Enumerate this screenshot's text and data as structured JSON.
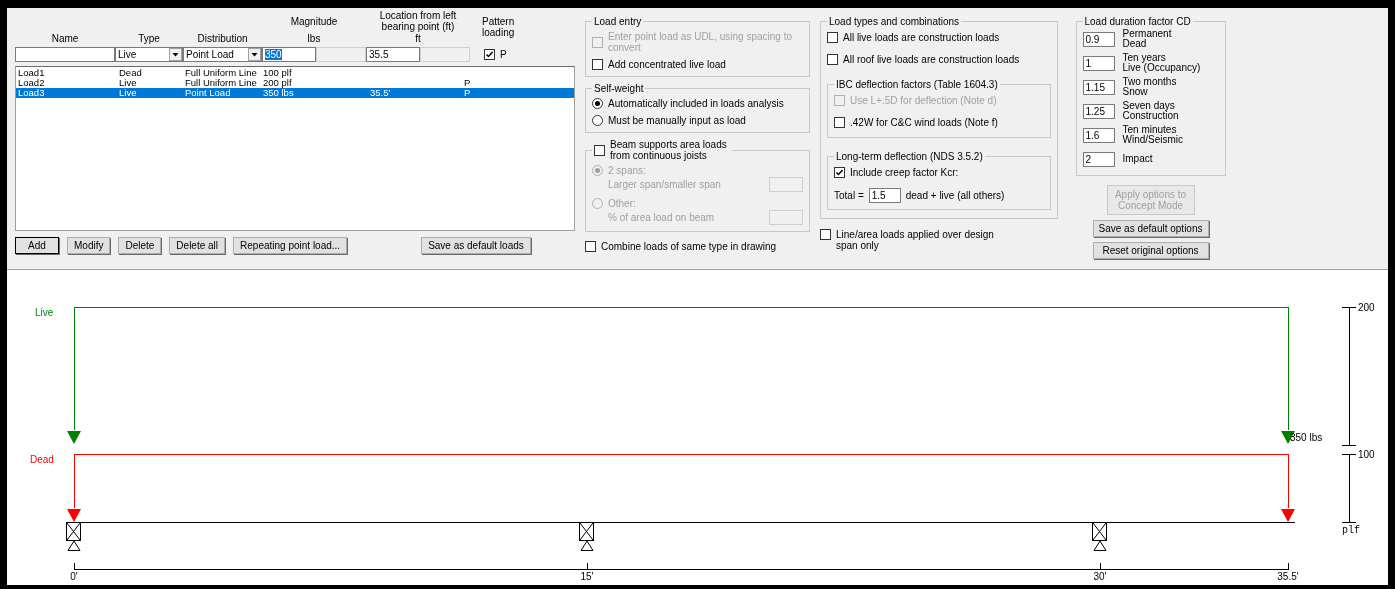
{
  "entry_form": {
    "headers": {
      "name": "Name",
      "type": "Type",
      "distribution": "Distribution",
      "magnitude": "Magnitude",
      "magnitude_unit": "lbs",
      "location": "Location from left bearing point (ft)",
      "location_unit": "ft",
      "pattern": "Pattern loading"
    },
    "type": "Live",
    "distribution": "Point Load",
    "magnitude": "350",
    "location": "35.5",
    "pattern": {
      "label": "P",
      "checked": true
    }
  },
  "loads": [
    {
      "name": "Load1",
      "type": "Dead",
      "distribution": "Full Uniform Line",
      "magnitude": "100 plf",
      "selected": false
    },
    {
      "name": "Load2",
      "type": "Live",
      "distribution": "Full Uniform Line",
      "magnitude": "200 plf",
      "pattern": "P",
      "selected": false
    },
    {
      "name": "Load3",
      "type": "Live",
      "distribution": "Point Load",
      "magnitude": "350 lbs",
      "location": "35.5'",
      "pattern": "P",
      "selected": true
    }
  ],
  "load_buttons": [
    "Add",
    "Modify",
    "Delete",
    "Delete all",
    "Repeating point load..."
  ],
  "save_loads_button": "Save as default loads",
  "load_entry": {
    "title": "Load entry",
    "options": [
      {
        "label": "Enter point load as UDL, using spacing to convert",
        "checked": false,
        "disabled": true
      },
      {
        "label": "Add concentrated live load",
        "checked": false,
        "disabled": false
      }
    ]
  },
  "self_weight": {
    "title": "Self-weight",
    "options": [
      {
        "label": "Automatically included in loads analysis",
        "selected": true
      },
      {
        "label": "Must be manually input as load",
        "selected": false
      }
    ]
  },
  "area_loads": {
    "title": "Beam supports area loads from continuous joists",
    "checked": false,
    "options": [
      {
        "label": "2 spans:",
        "sublabel": "Larger span/smaller span",
        "selected": true,
        "disabled": true
      },
      {
        "label": "Other:",
        "sublabel": "% of area load on beam",
        "selected": false,
        "disabled": true
      }
    ]
  },
  "combine": {
    "label": "Combine loads of same type in drawing",
    "checked": false
  },
  "load_types": {
    "title": "Load types and combinations",
    "options": [
      {
        "label": "All live loads are construction loads",
        "checked": false,
        "disabled": false
      },
      {
        "label": "All roof live loads are construction loads",
        "checked": false,
        "disabled": false
      }
    ],
    "ibc": {
      "title": "IBC deflection factors (Table 1604.3)",
      "options": [
        {
          "label": "Use L+.5D for deflection (Note d)",
          "checked": false,
          "disabled": true
        },
        {
          "label": ".42W for C&C wind loads (Note f)",
          "checked": false,
          "disabled": false
        }
      ]
    },
    "long_term": {
      "title": "Long-term deflection (NDS 3.5.2)",
      "creep": {
        "label": "Include creep factor Kcr:",
        "checked": true
      },
      "total_label": "Total =",
      "total_value": "1.5",
      "total_suffix": "dead + live (all others)"
    }
  },
  "design_span": {
    "label": "Line/area loads applied over design span only",
    "checked": false
  },
  "duration": {
    "title": "Load duration factor CD",
    "rows": [
      {
        "value": "0.9",
        "label": "Permanent",
        "sublabel": "Dead"
      },
      {
        "value": "1",
        "label": "Ten years",
        "sublabel": "Live (Occupancy)"
      },
      {
        "value": "1.15",
        "label": "Two months",
        "sublabel": "Snow"
      },
      {
        "value": "1.25",
        "label": "Seven days",
        "sublabel": "Construction"
      },
      {
        "value": "1.6",
        "label": "Ten minutes",
        "sublabel": "Wind/Seismic"
      },
      {
        "value": "2",
        "label": "Impact"
      }
    ]
  },
  "apply_button": {
    "label": "Apply options to Concept Mode",
    "disabled": true
  },
  "option_buttons": [
    "Save as default options",
    "Reset original options"
  ],
  "diagram": {
    "loads": [
      {
        "name": "Live",
        "color": "#008000"
      },
      {
        "name": "Dead",
        "color": "#ff0000"
      }
    ],
    "point_label": "350 lbs",
    "scale": [
      "200",
      "100",
      "plf"
    ],
    "ticks": [
      {
        "label": "0'",
        "support": true
      },
      {
        "label": "15'",
        "support": true
      },
      {
        "label": "30'",
        "support": true
      },
      {
        "label": "35.5'",
        "support": false
      }
    ]
  }
}
